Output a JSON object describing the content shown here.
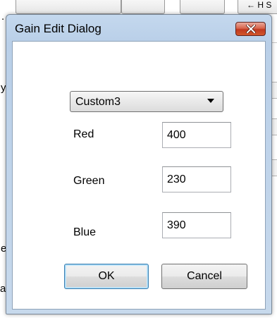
{
  "dialog": {
    "title": "Gain Edit Dialog",
    "preset": {
      "selected": "Custom3"
    },
    "fields": {
      "red": {
        "label": "Red",
        "value": "400"
      },
      "green": {
        "label": "Green",
        "value": "230"
      },
      "blue": {
        "label": "Blue",
        "value": "390"
      }
    },
    "buttons": {
      "ok": "OK",
      "cancel": "Cancel"
    },
    "icons": {
      "close": "close-icon",
      "dropdown": "chevron-down-icon"
    },
    "colors": {
      "titlebar": "#b9cfe8",
      "close_button": "#c7432a",
      "default_button_border": "#3c7fb1"
    }
  },
  "background": {
    "fragments": [
      ".",
      "y",
      "e",
      "ali",
      "← H S"
    ]
  }
}
